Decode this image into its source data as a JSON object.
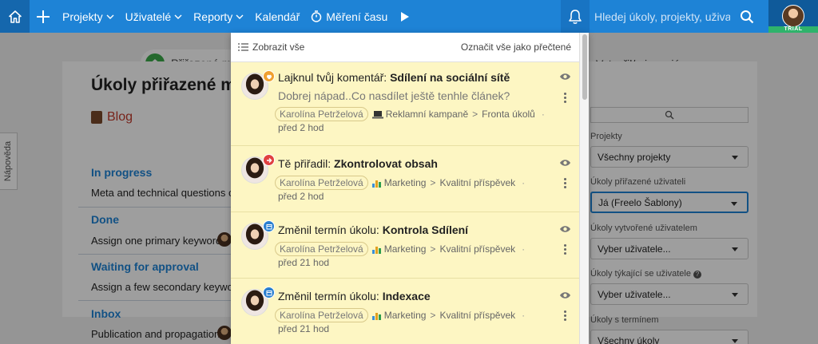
{
  "nav": {
    "items": [
      {
        "label": "Projekty",
        "dropdown": true
      },
      {
        "label": "Uživatelé",
        "dropdown": true
      },
      {
        "label": "Reporty",
        "dropdown": true
      },
      {
        "label": "Kalendář",
        "dropdown": false
      },
      {
        "label": "Měření času",
        "dropdown": false
      }
    ],
    "search_placeholder": "Hledej úkoly, projekty, uživatele",
    "trial_badge": "TRIAL",
    "colors": {
      "bar": "#1e83d6",
      "home": "#1567ad",
      "trial": "#2fb36b"
    }
  },
  "background": {
    "filter_pill": "Přiřazené mně",
    "created_tab": "Vytvořil/a jsem já",
    "help_tab": "Nápověda",
    "page_title": "Úkoly přiřazené mně",
    "project": "Blog",
    "groups": [
      {
        "status": "In progress",
        "task": "Meta and technical questions ch"
      },
      {
        "status": "Done",
        "task": "Assign one primary keyword"
      },
      {
        "status": "Waiting for approval",
        "task": "Assign a few secondary keywords"
      },
      {
        "status": "Inbox",
        "task": "Publication and propagation"
      }
    ],
    "sidebar": {
      "projects_label": "Projekty",
      "projects_value": "Všechny projekty",
      "assigned_label": "Úkoly přiřazené uživateli",
      "assigned_value": "Já (Freelo Šablony)",
      "created_label": "Úkoly vytvořené uživatelem",
      "created_value": "Vyber uživatele...",
      "concerning_label": "Úkoly týkající se uživatele",
      "concerning_value": "Vyber uživatele...",
      "deadline_label": "Úkoly s termínem",
      "deadline_value": "Všechny úkoly"
    }
  },
  "notifications": {
    "show_all": "Zobrazit vše",
    "mark_all_read": "Označit vše jako přečtené",
    "items": [
      {
        "action": "Lajknul tvůj komentář:",
        "task": "Sdílení na sociální sítě",
        "comment": "Dobrej nápad..Co nasdílet ještě tenhle článek?",
        "user": "Karolína Petrželová",
        "project": "Reklamní kampaně",
        "list": "Fronta úkolů",
        "time": "před 2 hod",
        "badge_icon": "like-icon",
        "badge_color": "#f0a030"
      },
      {
        "action": "Tě přiřadil:",
        "task": "Zkontrolovat obsah",
        "user": "Karolína Petrželová",
        "project": "Marketing",
        "list": "Kvalitní příspěvek",
        "time": "před 2 hod",
        "badge_icon": "assign-arrow-icon",
        "badge_color": "#e04040"
      },
      {
        "action": "Změnil termín úkolu:",
        "task": "Kontrola Sdílení",
        "user": "Karolína Petrželová",
        "project": "Marketing",
        "list": "Kvalitní příspěvek",
        "time": "před 21 hod",
        "badge_icon": "calendar-icon",
        "badge_color": "#2a7fd0"
      },
      {
        "action": "Změnil termín úkolu:",
        "task": "Indexace",
        "user": "Karolína Petrželová",
        "project": "Marketing",
        "list": "Kvalitní příspěvek",
        "time": "před 21 hod",
        "badge_icon": "calendar-icon",
        "badge_color": "#2a7fd0"
      }
    ]
  }
}
